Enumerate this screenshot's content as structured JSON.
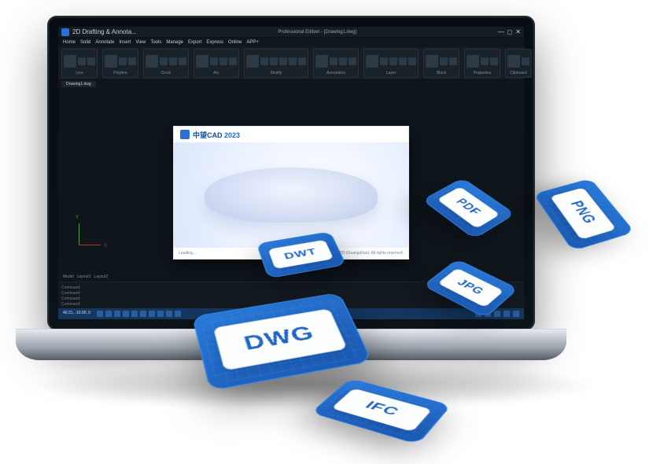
{
  "window": {
    "title": "Professional Edition - [Drawing1.dwg]",
    "tab": "2D Drafting & Annota..."
  },
  "menus": [
    "Home",
    "Solid",
    "Annotate",
    "Insert",
    "View",
    "Tools",
    "Manage",
    "Export",
    "Express",
    "Online",
    "APP+"
  ],
  "ribbon_groups": [
    {
      "label": "Line",
      "icons": 3
    },
    {
      "label": "Polyline",
      "icons": 3
    },
    {
      "label": "Circle",
      "icons": 4
    },
    {
      "label": "Arc",
      "icons": 4
    },
    {
      "label": "Modify",
      "icons": 6
    },
    {
      "label": "Annotation",
      "icons": 4
    },
    {
      "label": "Layer",
      "icons": 5
    },
    {
      "label": "Block",
      "icons": 3
    },
    {
      "label": "Properties",
      "icons": 3
    },
    {
      "label": "Clipboard",
      "icons": 2
    }
  ],
  "doc_tab": "Drawing1.dwg",
  "axis": {
    "x": "X",
    "y": "Y"
  },
  "model_tabs": [
    "Model",
    "Layout1",
    "Layout2"
  ],
  "splash": {
    "brand": "中望",
    "product": "CAD",
    "year": "2023",
    "loading": "Loading...",
    "copyright": "© 1998-2022 ZWSOFT CO., LTD.(Guangzhou). All rights reserved."
  },
  "command_lines": [
    "Command:",
    "Command:",
    "Command:",
    "Command:"
  ],
  "status": {
    "coords": "40.21, -10.00, 0",
    "icons": 10
  },
  "file_tiles": [
    {
      "ext": "DWG"
    },
    {
      "ext": "DWT"
    },
    {
      "ext": "PDF"
    },
    {
      "ext": "JPG"
    },
    {
      "ext": "PNG"
    },
    {
      "ext": "IFC"
    }
  ]
}
